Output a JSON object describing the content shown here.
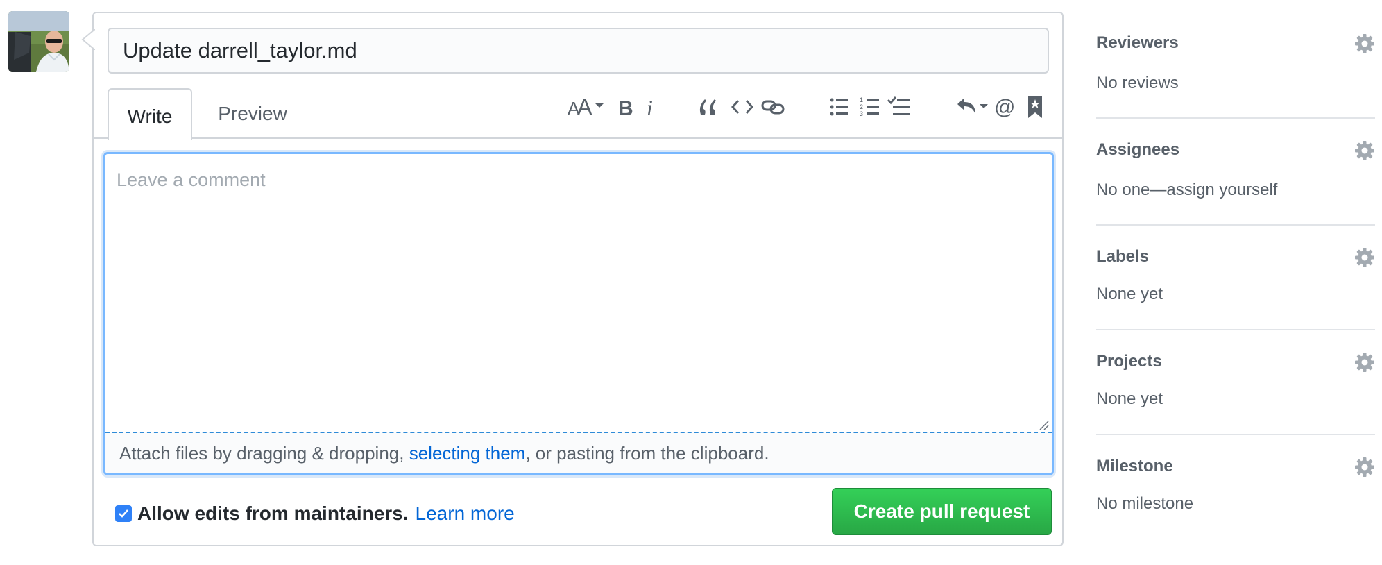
{
  "pr_form": {
    "title_value": "Update darrell_taylor.md",
    "tabs": [
      {
        "label": "Write",
        "selected": true
      },
      {
        "label": "Preview",
        "selected": false
      }
    ],
    "toolbar_icons": [
      "text-size-icon",
      "bold-icon",
      "italic-icon",
      "quote-icon",
      "code-icon",
      "link-icon",
      "bullet-list-icon",
      "numbered-list-icon",
      "task-list-icon",
      "reply-icon",
      "mention-icon",
      "saved-reply-icon"
    ],
    "comment": {
      "placeholder": "Leave a comment",
      "value": ""
    },
    "attach": {
      "before": "Attach files by dragging & dropping, ",
      "link": "selecting them",
      "after": ", or pasting from the clipboard."
    },
    "allow_edits": {
      "checked": true,
      "label": "Allow edits from maintainers.",
      "learn_more": "Learn more"
    },
    "submit_label": "Create pull request"
  },
  "sidebar": {
    "reviewers": {
      "title": "Reviewers",
      "value": "No reviews"
    },
    "assignees": {
      "title": "Assignees",
      "value": "No one—assign yourself"
    },
    "labels": {
      "title": "Labels",
      "value": "None yet"
    },
    "projects": {
      "title": "Projects",
      "value": "None yet"
    },
    "milestone": {
      "title": "Milestone",
      "value": "No milestone"
    }
  },
  "colors": {
    "accent_blue": "#0366d6",
    "create_green": "#2ea44f",
    "border": "#d1d5da",
    "focus_blue": "#79b8ff"
  }
}
